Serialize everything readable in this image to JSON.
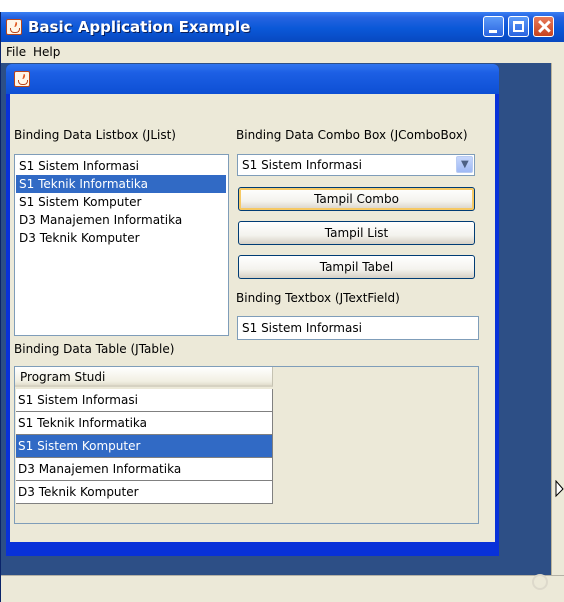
{
  "window": {
    "title": "Basic Application Example",
    "menu": [
      "File",
      "Help"
    ]
  },
  "panel": {
    "list_label": "Binding Data Listbox (JList)",
    "list_items": [
      "S1 Sistem Informasi",
      "S1 Teknik Informatika",
      "S1 Sistem Komputer",
      "D3 Manajemen Informatika",
      "D3 Teknik Komputer"
    ],
    "list_selected_index": 1,
    "combo_label": "Binding Data Combo Box (JComboBox)",
    "combo_value": "S1 Sistem Informasi",
    "buttons": [
      "Tampil Combo",
      "Tampil List",
      "Tampil Tabel"
    ],
    "textbox_label": "Binding Textbox (JTextField)",
    "textbox_value": "S1 Sistem Informasi",
    "table_label": "Binding Data Table (JTable)",
    "table_header": "Program Studi",
    "table_rows": [
      "S1 Sistem Informasi",
      "S1 Teknik Informatika",
      "S1 Sistem Komputer",
      "D3 Manajemen Informatika",
      "D3 Teknik Komputer"
    ],
    "table_selected_index": 2
  },
  "icons": {
    "app": "java-cup-icon",
    "combo_arrow": "chevron-down-icon",
    "caption_buttons": [
      "minimize-icon",
      "maximize-icon",
      "close-icon"
    ]
  },
  "colors": {
    "titlebar": "#0a58d8",
    "selection": "#316ac5",
    "desktop": "#2d4f86",
    "surface": "#ece9d8"
  }
}
